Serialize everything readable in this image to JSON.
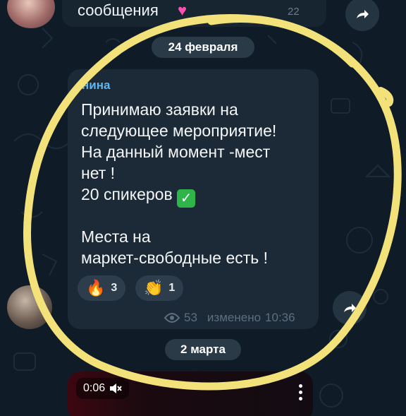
{
  "previous_message": {
    "text": "сообщения",
    "emoji": "♥",
    "time": "22"
  },
  "date_separators": [
    "24 февраля",
    "2 марта"
  ],
  "message": {
    "sender": "нина",
    "lines": [
      "Принимаю заявки на",
      "следующее мероприятие!",
      "На данный момент -мест",
      "нет !",
      "20 спикеров",
      "",
      "Места на",
      "маркет-свободные есть !"
    ],
    "check_emoji": "✓",
    "reactions": [
      {
        "emoji": "🔥",
        "count": "3",
        "icon": "fire-icon"
      },
      {
        "emoji": "👏",
        "count": "1",
        "icon": "clapping-hands-icon"
      }
    ],
    "views": "53",
    "edited_label": "изменено",
    "time": "10:36"
  },
  "video_message": {
    "duration": "0:06",
    "mute_icon": "speaker-muted-icon"
  },
  "colors": {
    "background": "#0f1c27",
    "bubble": "#1b2a36",
    "sender_name": "#5fb6f0",
    "highlight_circle": "#f3e27a",
    "reaction_pill": "#2d3d4b"
  }
}
